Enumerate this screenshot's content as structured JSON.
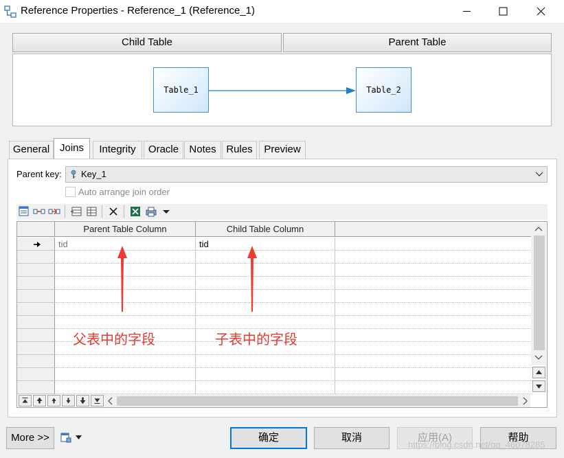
{
  "window": {
    "title": "Reference Properties - Reference_1 (Reference_1)",
    "controls": {
      "minimize": "minimize-icon",
      "maximize": "maximize-icon",
      "close": "close-icon"
    }
  },
  "header": {
    "child_table_label": "Child Table",
    "parent_table_label": "Parent Table"
  },
  "diagram": {
    "child_table": "Table_1",
    "parent_table": "Table_2",
    "colors": {
      "box_border": "#3f8fd3",
      "arrow": "#1f7fc4"
    }
  },
  "tabs": [
    {
      "label": "General",
      "active": false
    },
    {
      "label": "Joins",
      "active": true
    },
    {
      "label": "Integrity",
      "active": false
    },
    {
      "label": "Oracle",
      "active": false
    },
    {
      "label": "Notes",
      "active": false
    },
    {
      "label": "Rules",
      "active": false
    },
    {
      "label": "Preview",
      "active": false
    }
  ],
  "joins": {
    "parent_key_label": "Parent key:",
    "parent_key_value": "Key_1",
    "auto_arrange_label": "Auto arrange join order",
    "auto_arrange_checked": false,
    "toolbar_icons": [
      "properties-icon",
      "add-join-icon",
      "reuse-columns-icon",
      "insert-row-icon",
      "add-row-icon",
      "delete-icon",
      "excel-icon",
      "print-icon",
      "dropdown-icon"
    ],
    "columns": [
      "Parent Table Column",
      "Child Table Column"
    ],
    "rows": [
      {
        "parent": "tid",
        "child": "tid",
        "current": true
      }
    ],
    "nav_icons": [
      "move-top-icon",
      "move-page-up-icon",
      "move-up-icon",
      "move-down-icon",
      "move-page-down-icon",
      "move-bottom-icon"
    ]
  },
  "annotations": {
    "left": "父表中的字段",
    "right": "子表中的字段",
    "color": "#e53a2e"
  },
  "buttons": {
    "more": "More >>",
    "ok": "确定",
    "cancel": "取消",
    "apply": "应用(A)",
    "help": "帮助"
  },
  "watermark": "https://blog.csdn.net/qq_46078285"
}
